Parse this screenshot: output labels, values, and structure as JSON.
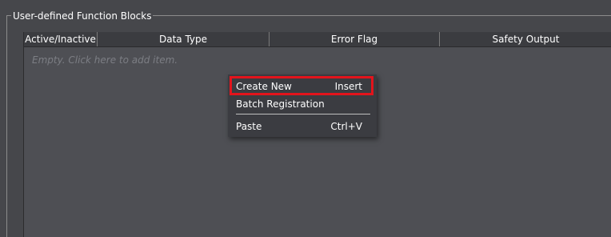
{
  "group": {
    "title": "User-defined Function Blocks"
  },
  "grid": {
    "columns": [
      "Active/Inactive",
      "Data Type",
      "Error Flag",
      "Safety Output"
    ],
    "empty_hint": "Empty. Click here to add item."
  },
  "context_menu": {
    "items": [
      {
        "label": "Create New",
        "shortcut": "Insert",
        "highlighted": true
      },
      {
        "label": "Batch Registration",
        "shortcut": ""
      },
      {
        "label": "Paste",
        "shortcut": "Ctrl+V"
      }
    ],
    "highlight_color": "#e3141c"
  }
}
